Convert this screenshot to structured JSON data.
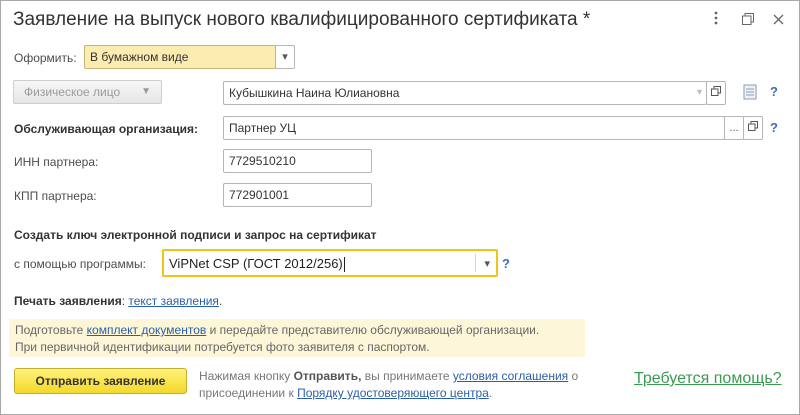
{
  "window": {
    "title": "Заявление на выпуск нового квалифицированного сертификата *",
    "more_icon": "more-vertical-icon",
    "restore_icon": "restore-window-icon",
    "close_icon": "close-icon"
  },
  "form": {
    "issue_label": "Оформить:",
    "issue_value": "В бумажном виде",
    "person_type_button": "Физическое лицо",
    "person_name": "Кубышкина Наина Юлиановна",
    "service_org_label": "Обслуживающая организация:",
    "service_org_value": "Партнер УЦ",
    "inn_label": "ИНН партнера:",
    "inn_value": "7729510210",
    "kpp_label": "КПП партнера:",
    "kpp_value": "772901001",
    "key_section_title": "Создать ключ электронной подписи и запрос на сертификат",
    "program_label": "с помощью программы:",
    "program_value": "ViPNet CSP (ГОСТ 2012/256)",
    "print_label": "Печать заявления",
    "print_sep": ": ",
    "print_link": "текст заявления",
    "print_end": ".",
    "help_mark": "?"
  },
  "note": {
    "part1": "Подготовьте ",
    "link": "комплект документов",
    "part2": " и передайте представителю обслуживающей организации.",
    "line2": "При первичной идентификации потребуется фото заявителя с паспортом."
  },
  "footer": {
    "send_button": "Отправить заявление",
    "consent_part1": "Нажимая кнопку ",
    "consent_bold": "Отправить,",
    "consent_part2": " вы принимаете ",
    "consent_link1": "условия соглашения",
    "consent_part3": " о присоединении к ",
    "consent_link2": "Порядку удостоверяющего центра",
    "consent_end": ".",
    "help_link": "Требуется помощь?"
  }
}
